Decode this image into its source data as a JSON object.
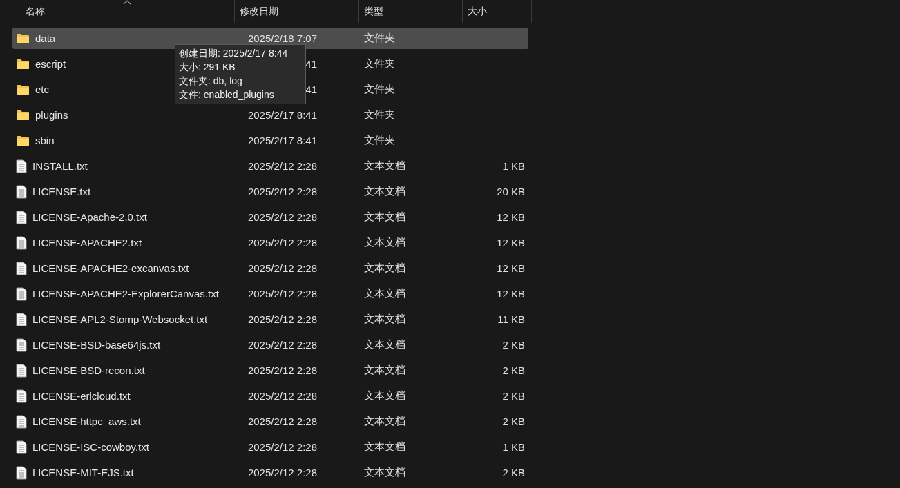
{
  "columns": [
    {
      "label": "名称",
      "sorted": true
    },
    {
      "label": "修改日期",
      "sorted": false
    },
    {
      "label": "类型",
      "sorted": false
    },
    {
      "label": "大小",
      "sorted": false
    }
  ],
  "rows": [
    {
      "kind": "folder",
      "name": "data",
      "date": "2025/2/18 7:07",
      "type": "文件夹",
      "selected": true
    },
    {
      "kind": "folder",
      "name": "escript",
      "date": "41",
      "type": "文件夹",
      "selected": false
    },
    {
      "kind": "folder",
      "name": "etc",
      "date": "41",
      "type": "文件夹",
      "selected": false
    },
    {
      "kind": "folder",
      "name": "plugins",
      "date": "2025/2/17 8:41",
      "type": "文件夹",
      "selected": false
    },
    {
      "kind": "folder",
      "name": "sbin",
      "date": "2025/2/17 8:41",
      "type": "文件夹",
      "selected": false
    },
    {
      "kind": "file",
      "name": "INSTALL.txt",
      "date": "2025/2/12 2:28",
      "type": "文本文档",
      "size": "1 KB",
      "selected": false
    },
    {
      "kind": "file",
      "name": "LICENSE.txt",
      "date": "2025/2/12 2:28",
      "type": "文本文档",
      "size": "20 KB",
      "selected": false
    },
    {
      "kind": "file",
      "name": "LICENSE-Apache-2.0.txt",
      "date": "2025/2/12 2:28",
      "type": "文本文档",
      "size": "12 KB",
      "selected": false
    },
    {
      "kind": "file",
      "name": "LICENSE-APACHE2.txt",
      "date": "2025/2/12 2:28",
      "type": "文本文档",
      "size": "12 KB",
      "selected": false
    },
    {
      "kind": "file",
      "name": "LICENSE-APACHE2-excanvas.txt",
      "date": "2025/2/12 2:28",
      "type": "文本文档",
      "size": "12 KB",
      "selected": false
    },
    {
      "kind": "file",
      "name": "LICENSE-APACHE2-ExplorerCanvas.txt",
      "date": "2025/2/12 2:28",
      "type": "文本文档",
      "size": "12 KB",
      "selected": false
    },
    {
      "kind": "file",
      "name": "LICENSE-APL2-Stomp-Websocket.txt",
      "date": "2025/2/12 2:28",
      "type": "文本文档",
      "size": "11 KB",
      "selected": false
    },
    {
      "kind": "file",
      "name": "LICENSE-BSD-base64js.txt",
      "date": "2025/2/12 2:28",
      "type": "文本文档",
      "size": "2 KB",
      "selected": false
    },
    {
      "kind": "file",
      "name": "LICENSE-BSD-recon.txt",
      "date": "2025/2/12 2:28",
      "type": "文本文档",
      "size": "2 KB",
      "selected": false
    },
    {
      "kind": "file",
      "name": "LICENSE-erlcloud.txt",
      "date": "2025/2/12 2:28",
      "type": "文本文档",
      "size": "2 KB",
      "selected": false
    },
    {
      "kind": "file",
      "name": "LICENSE-httpc_aws.txt",
      "date": "2025/2/12 2:28",
      "type": "文本文档",
      "size": "2 KB",
      "selected": false
    },
    {
      "kind": "file",
      "name": "LICENSE-ISC-cowboy.txt",
      "date": "2025/2/12 2:28",
      "type": "文本文档",
      "size": "1 KB",
      "selected": false
    },
    {
      "kind": "file",
      "name": "LICENSE-MIT-EJS.txt",
      "date": "2025/2/12 2:28",
      "type": "文本文档",
      "size": "2 KB",
      "selected": false
    }
  ],
  "tooltip": [
    "创建日期: 2025/2/17 8:44",
    "大小: 291 KB",
    "文件夹: db, log",
    "文件: enabled_plugins"
  ]
}
